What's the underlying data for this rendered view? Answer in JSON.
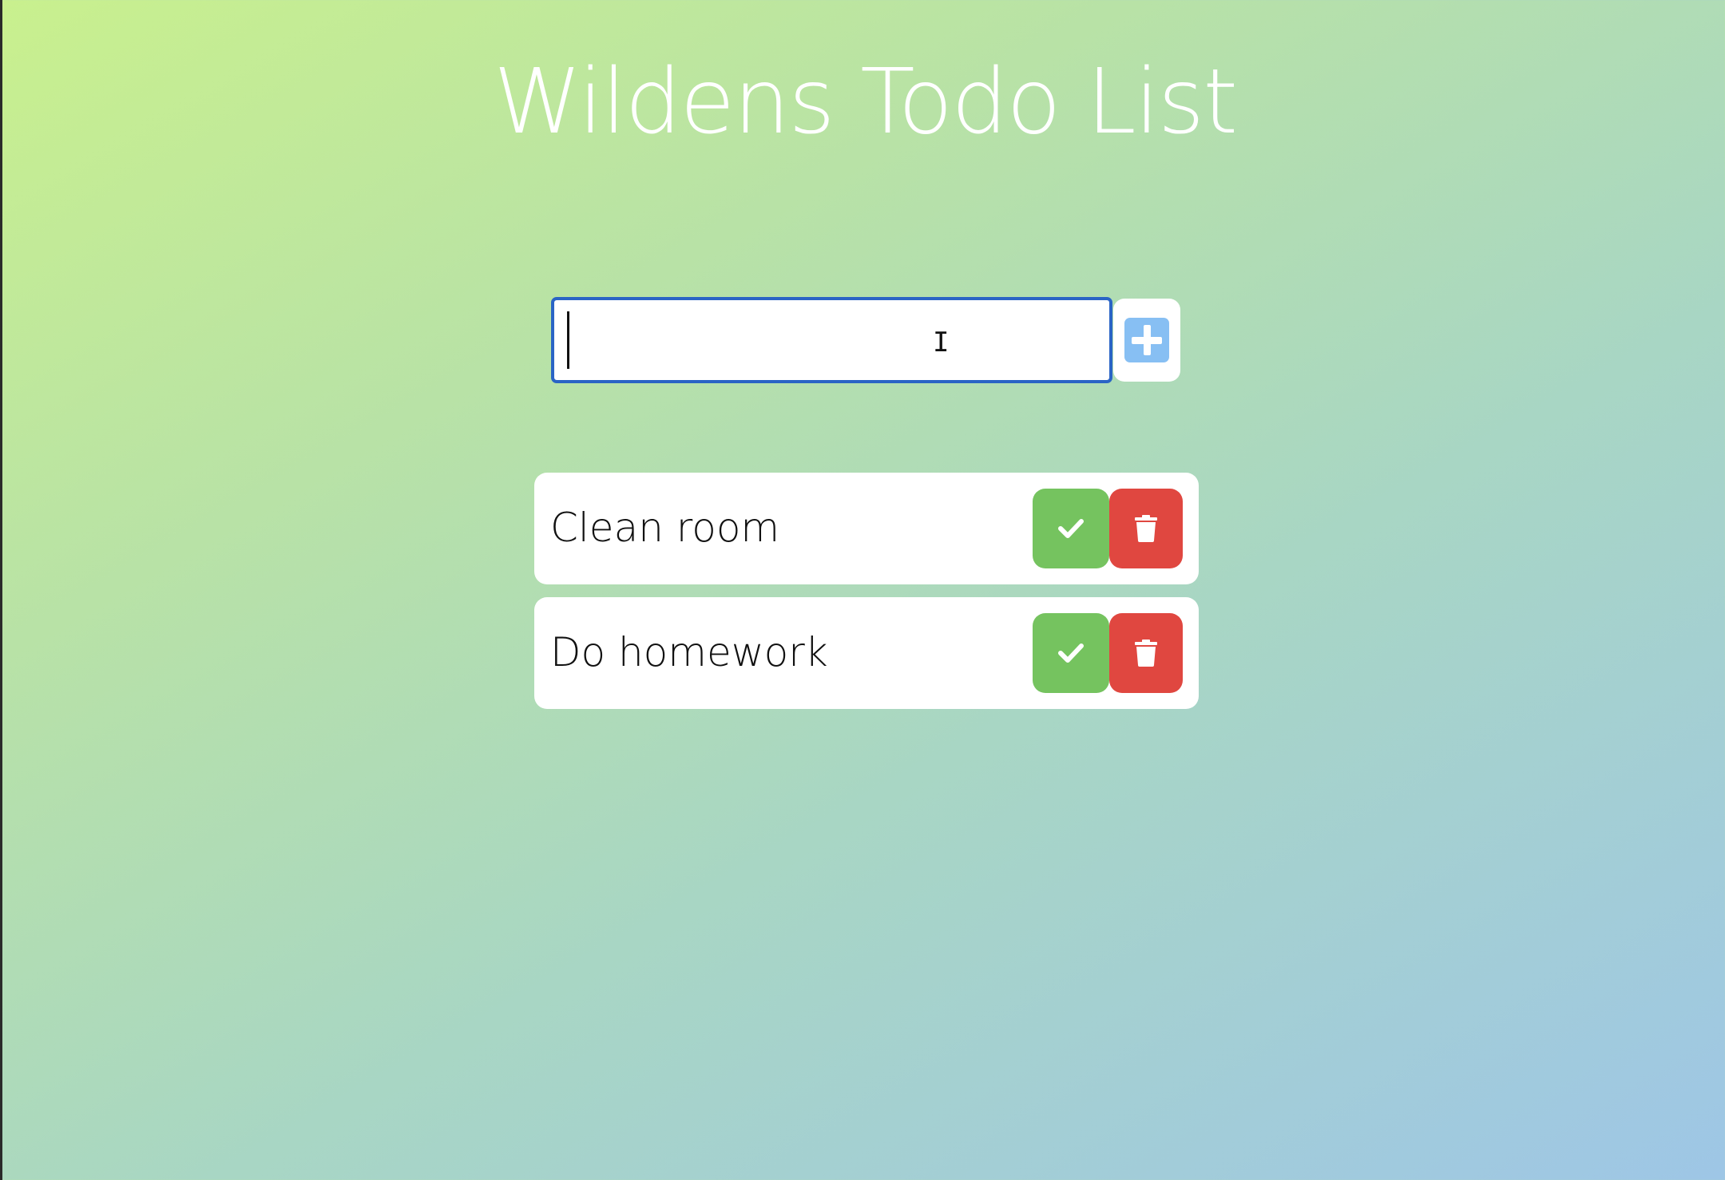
{
  "header": {
    "title": "Wildens Todo List"
  },
  "new_todo": {
    "value": "",
    "add_icon": "plus-square-icon"
  },
  "todos": [
    {
      "text": "Clean room",
      "complete_icon": "check-icon",
      "delete_icon": "trash-icon"
    },
    {
      "text": "Do homework",
      "complete_icon": "check-icon",
      "delete_icon": "trash-icon"
    }
  ],
  "colors": {
    "complete_button": "#75c35f",
    "delete_button": "#e04740",
    "add_icon": "#87bff3",
    "input_focus_border": "#2a64c5"
  }
}
